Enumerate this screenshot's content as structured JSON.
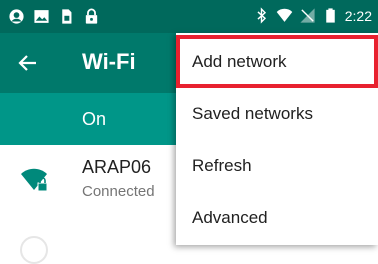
{
  "status_bar": {
    "time": "2:22",
    "left_icons": [
      "notification-icon",
      "image-icon",
      "sim-icon",
      "lock-icon"
    ],
    "right_icons": [
      "bluetooth-icon",
      "wifi-signal-icon",
      "no-cell-signal-icon",
      "battery-icon"
    ]
  },
  "toolbar": {
    "title": "Wi-Fi"
  },
  "switch_bar": {
    "label": "On"
  },
  "networks": [
    {
      "name": "ARAP06",
      "status": "Connected"
    }
  ],
  "overflow_menu": {
    "items": [
      {
        "label": "Add network"
      },
      {
        "label": "Saved networks"
      },
      {
        "label": "Refresh"
      },
      {
        "label": "Advanced"
      }
    ]
  },
  "colors": {
    "status_bar": "#00695c",
    "toolbar": "#00796b",
    "switch_bar": "#009688",
    "wifi_icon": "#00897b",
    "highlight": "#e8212f"
  }
}
